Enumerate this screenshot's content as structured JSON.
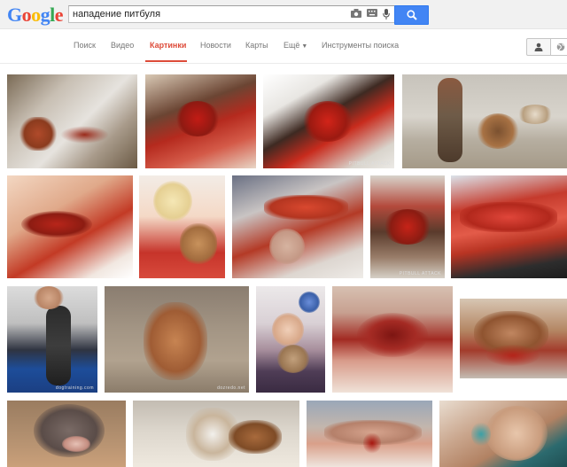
{
  "logo": {
    "letters": [
      "G",
      "o",
      "o",
      "g",
      "l",
      "e"
    ]
  },
  "search": {
    "query": "нападение питбуля"
  },
  "tabs": {
    "search": "Поиск",
    "video": "Видео",
    "images": "Картинки",
    "news": "Новости",
    "maps": "Карты",
    "more": "Ещё",
    "tools": "Инструменты поиска"
  },
  "colors": {
    "accent_red": "#dd4b39",
    "button_blue": "#4285f4"
  },
  "images": {
    "captions": [
      "PITBULL ATTACK",
      "PITBULL ATTACK",
      "dogtraining.com",
      "dozredo.net"
    ]
  }
}
